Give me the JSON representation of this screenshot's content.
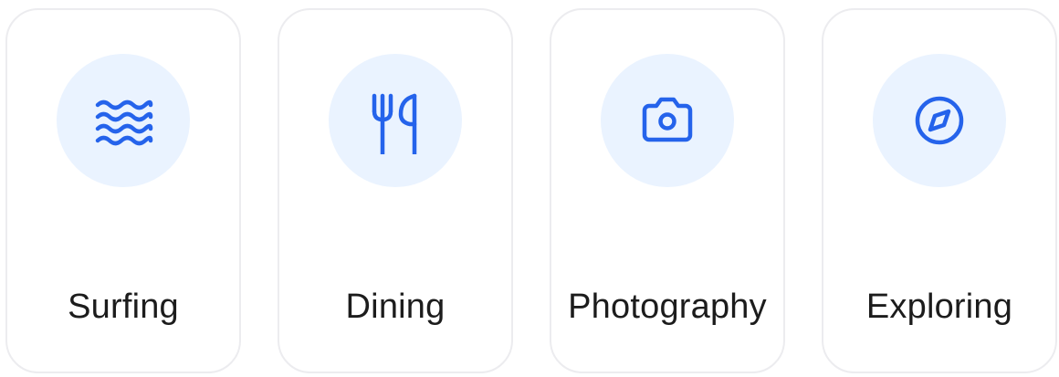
{
  "theme": {
    "accent": "#2563eb",
    "icon_bg": "#eaf3ff",
    "card_border": "#ececef",
    "text": "#1c1c1c"
  },
  "categories": [
    {
      "label": "Surfing",
      "icon": "waves-icon"
    },
    {
      "label": "Dining",
      "icon": "fork-knife-icon"
    },
    {
      "label": "Photography",
      "icon": "camera-icon"
    },
    {
      "label": "Exploring",
      "icon": "compass-icon"
    }
  ]
}
